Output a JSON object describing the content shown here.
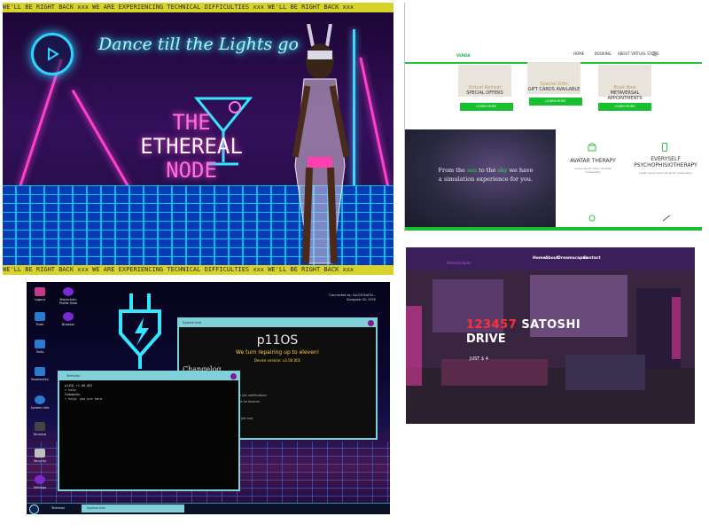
{
  "collage": {
    "ethereal": {
      "ticker_top": "WE'LL BE RIGHT BACK xxx WE ARE EXPERIENCING TECHNICAL DIFFICULTIES xxx WE'LL BE RIGHT BACK xxx",
      "ticker_bottom": "WE'LL BE RIGHT BACK xxx WE ARE EXPERIENCING TECHNICAL DIFFICULTIES xxx WE'LL BE RIGHT BACK xxx",
      "title": "Dance till the Lights go",
      "sign_line1": "THE",
      "sign_line2": "ETHEREAL",
      "sign_line3": "NODE"
    },
    "verda": {
      "logo": "VERDA",
      "nav": [
        "HOME",
        "BOOKING",
        "ABOUT VIRTUAL STORE"
      ],
      "cards": [
        {
          "script": "Virtual Retreat",
          "label": "SPECIAL OFFERS",
          "button": "LEARN MORE"
        },
        {
          "script": "Special Gifts",
          "label": "GIFT CARDS AVAILABLE",
          "button": "LEARN MORE"
        },
        {
          "script": "Book Now",
          "label": "METAVERSAL APPOINTMENTS",
          "button": "LEARN MORE"
        }
      ],
      "space_text_a": "From the",
      "space_text_hl1": "sea",
      "space_text_b": "to the",
      "space_text_hl2": "sky",
      "space_text_c": "we have a simulation experience for you.",
      "features": [
        {
          "title": "AVATAR THERAPY",
          "desc": "Lorem ipsum dolor sit amet consectetur"
        },
        {
          "title": "EVERYSELF PSYCHOPHISIOTHERAPY",
          "desc": "Lorem ipsum dolor sit amet consectetur"
        }
      ]
    },
    "p11os": {
      "desktop_icons": [
        {
          "label": "Logout",
          "color": "#c23a8a"
        },
        {
          "label": "Trash",
          "color": "#2a7ad0"
        },
        {
          "label": "Tools",
          "color": "#2a7ad0"
        },
        {
          "label": "Bookmarks",
          "color": "#2a7ad0"
        },
        {
          "label": "System Info",
          "color": "#2a7ad0"
        },
        {
          "label": "Terminal",
          "color": "#444444"
        },
        {
          "label": "Security",
          "color": "#c0c0c0"
        },
        {
          "label": "Settings",
          "color": "#7a2ad0"
        }
      ],
      "desktop_icons_col2": [
        {
          "label": "Blockchain Profile Data",
          "color": "#7a2ad0"
        },
        {
          "label": "Browser",
          "color": "#7a2ad0"
        }
      ],
      "connected_line1": "Connected as: 0xc2350af7b...",
      "connected_line2": "Stargazer ID: 2935",
      "sysinfo_title": "System Info",
      "os_name": "p11OS",
      "tagline": "We turn repairing up to eleven!",
      "version": "Device version: v2.00.001",
      "changelog_title": "Changelog",
      "changelog_lines": [
        "all job notifications",
        "me on beacon",
        "in job hub"
      ],
      "terminal_title": "Terminal",
      "terminal_lines": [
        "p11OS >1.00.001",
        "> help",
        "Commands:",
        "  • help: you are here"
      ],
      "taskbar_items": [
        "Terminal",
        "System Info"
      ]
    },
    "satoshi": {
      "brand": "Dreamscapes",
      "nav": [
        "Home",
        "About",
        "Dreamscapes",
        "Contact"
      ],
      "hero_num": "123457",
      "hero_word": "SATOSHI",
      "hero_line2": "DRIVE",
      "subtitle": "JUST $ 4"
    }
  }
}
